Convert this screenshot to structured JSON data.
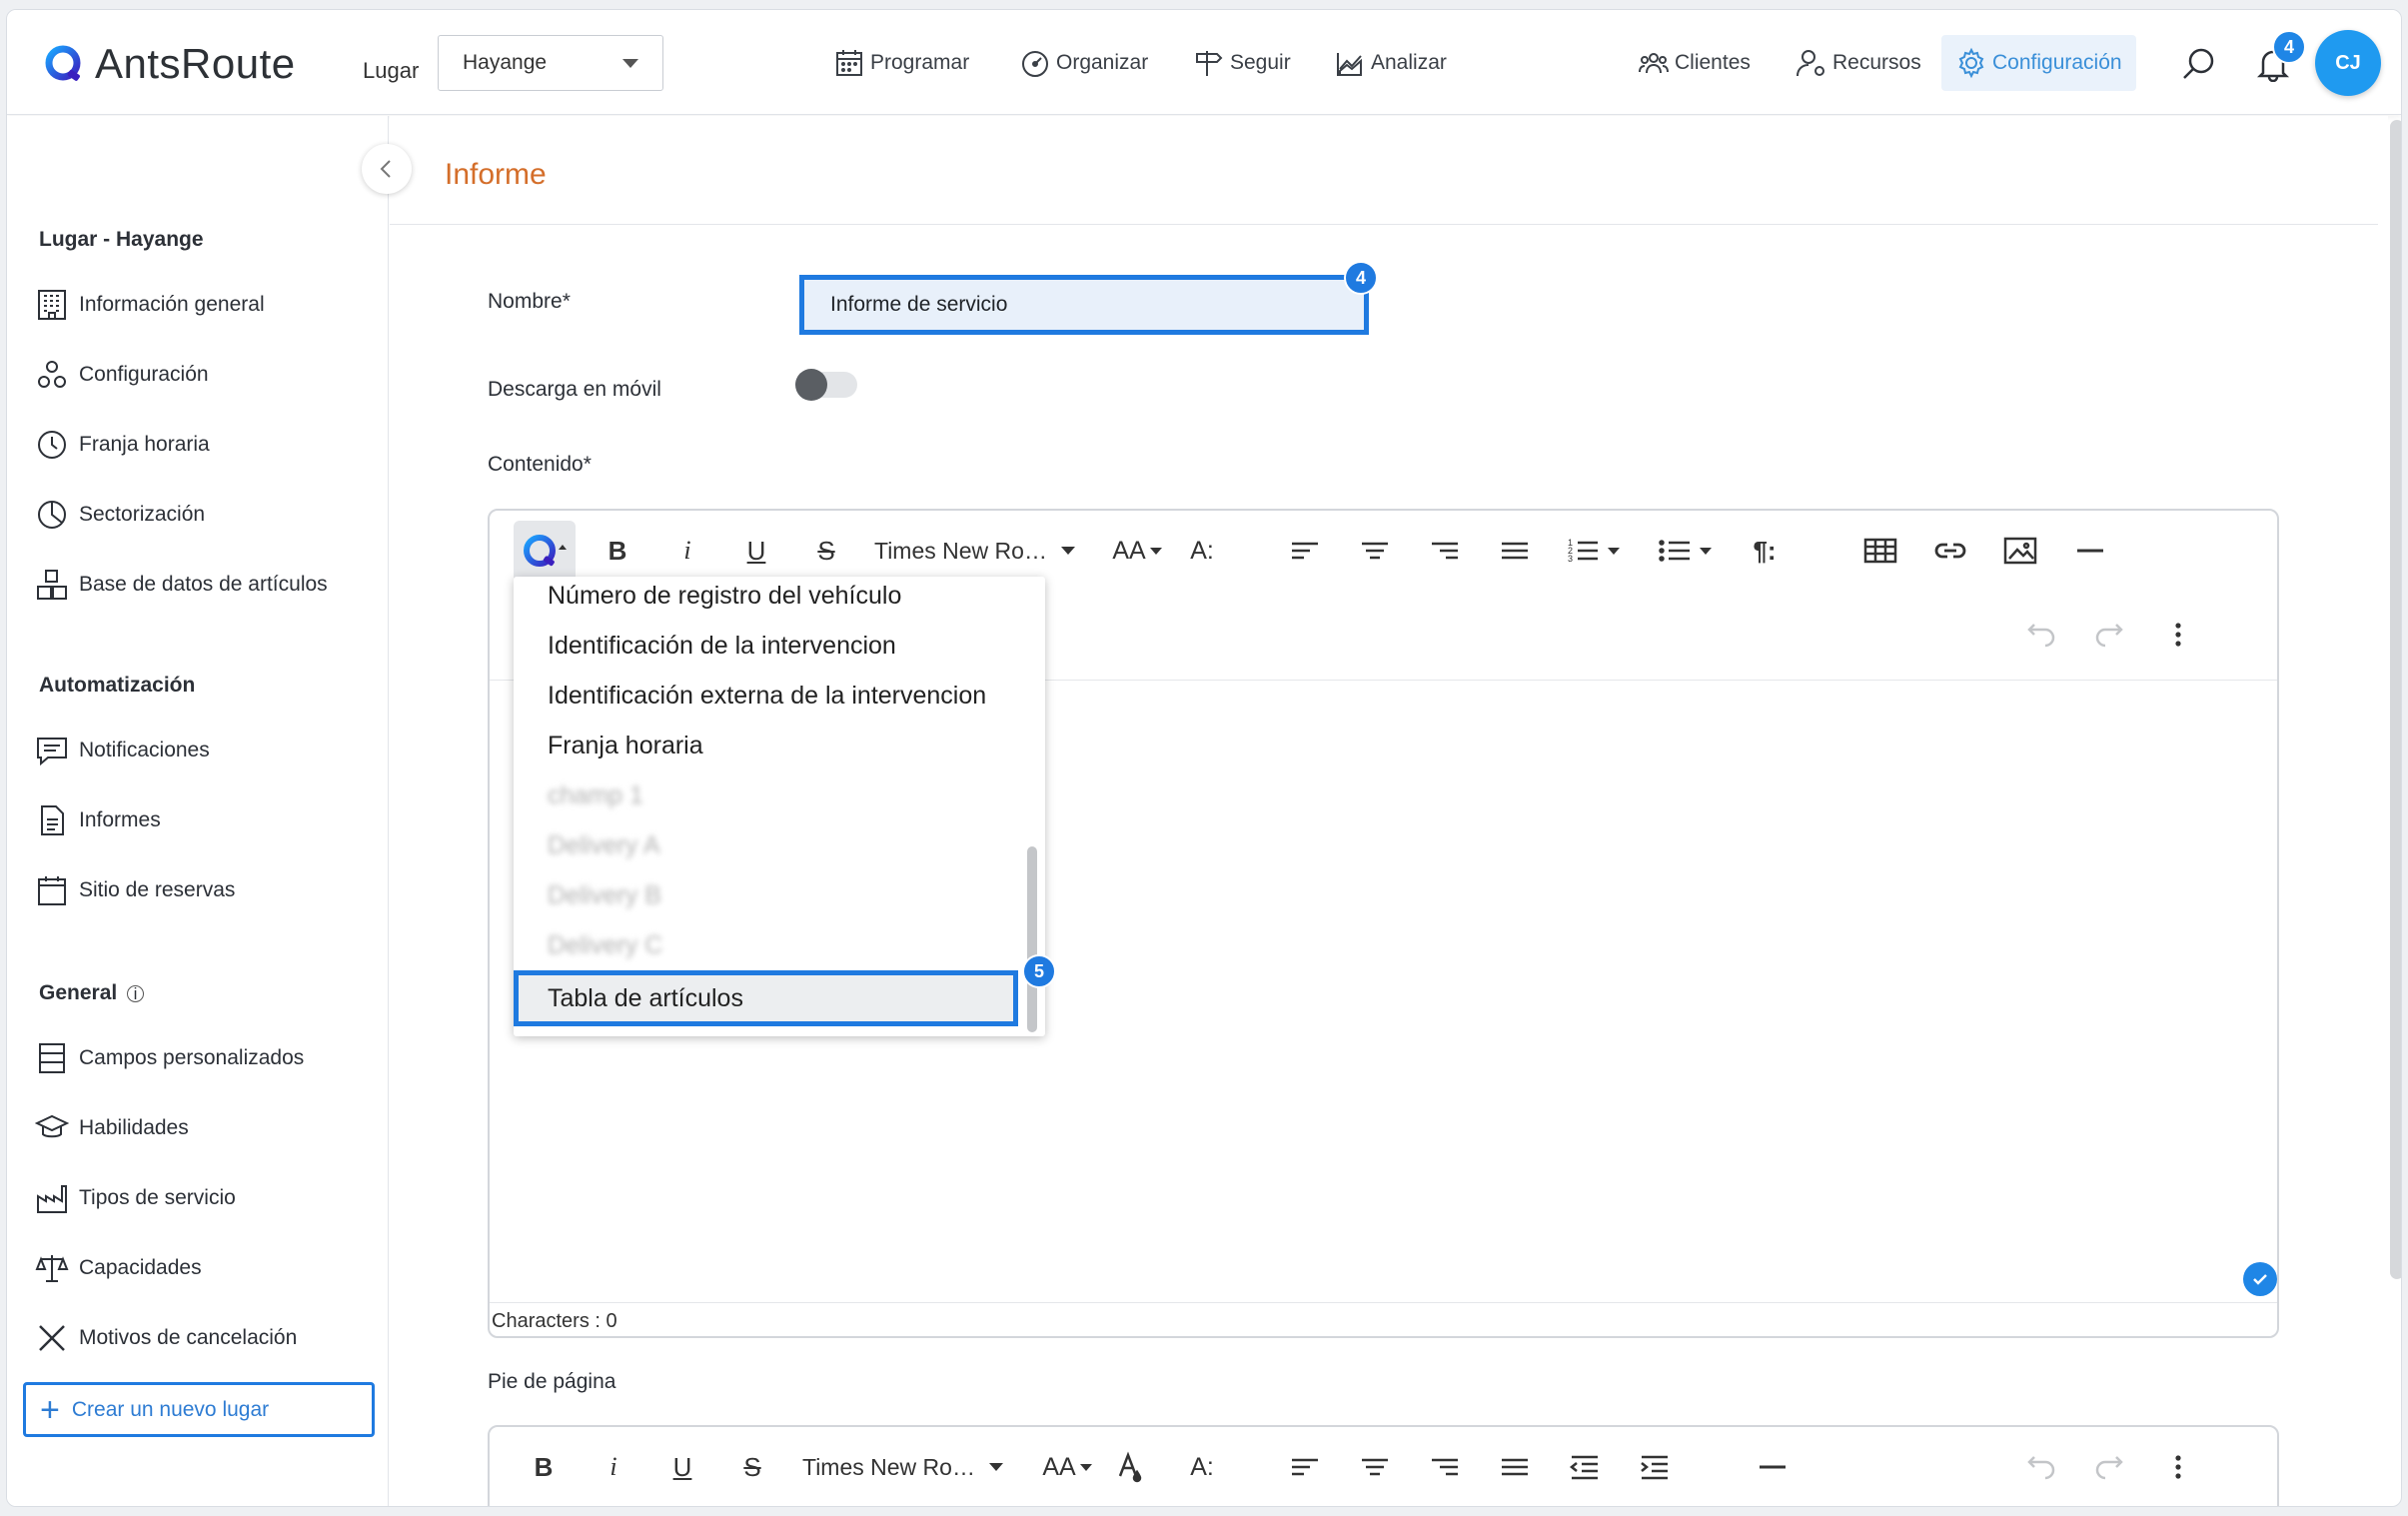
{
  "header": {
    "brand": "AntsRoute",
    "lugar_label": "Lugar",
    "lugar_value": "Hayange",
    "nav": [
      {
        "label": "Programar",
        "icon": "calendar-icon"
      },
      {
        "label": "Organizar",
        "icon": "speedometer-icon"
      },
      {
        "label": "Seguir",
        "icon": "signpost-icon"
      },
      {
        "label": "Analizar",
        "icon": "chart-icon"
      }
    ],
    "right_nav": [
      {
        "label": "Clientes",
        "icon": "users-icon"
      },
      {
        "label": "Recursos",
        "icon": "user-gear-icon"
      },
      {
        "label": "Configuración",
        "icon": "gear-icon",
        "active": true
      }
    ],
    "notification_count": "4",
    "avatar_initials": "CJ"
  },
  "sidebar": {
    "section_lugar": "Lugar - Hayange",
    "lugar_items": [
      "Información general",
      "Configuración",
      "Franja horaria",
      "Sectorización",
      "Base de datos de artículos"
    ],
    "section_auto": "Automatización",
    "auto_items": [
      "Notificaciones",
      "Informes",
      "Sitio de reservas"
    ],
    "section_general": "General",
    "general_items": [
      "Campos personalizados",
      "Habilidades",
      "Tipos de servicio",
      "Capacidades",
      "Motivos de cancelación"
    ],
    "new_lugar": "Crear un nuevo lugar"
  },
  "main": {
    "title": "Informe",
    "name_label": "Nombre*",
    "name_value": "Informe de servicio",
    "name_step": "4",
    "download_label": "Descarga en móvil",
    "content_label": "Contenido*",
    "toolbar": {
      "font": "Times New Ro…",
      "bold": "B",
      "italic": "i",
      "underline": "U",
      "strike": "S",
      "font_size": "AA",
      "line_height": "A:",
      "paragraph": "¶:"
    },
    "dropdown": {
      "items": [
        "Número de registro del vehículo",
        "Identificación de la intervencion",
        "Identificación externa de la intervencion",
        "Franja horaria"
      ],
      "blurred_items": [
        "champ 1",
        "Delivery A",
        "Delivery B",
        "Delivery C"
      ],
      "selected": "Tabla de artículos",
      "selected_step": "5"
    },
    "characters": "Characters : 0",
    "footer_label": "Pie de página"
  },
  "colors": {
    "accent": "#1f7ae0",
    "title": "#d46e2a",
    "active_nav": "#3a8fd8"
  }
}
